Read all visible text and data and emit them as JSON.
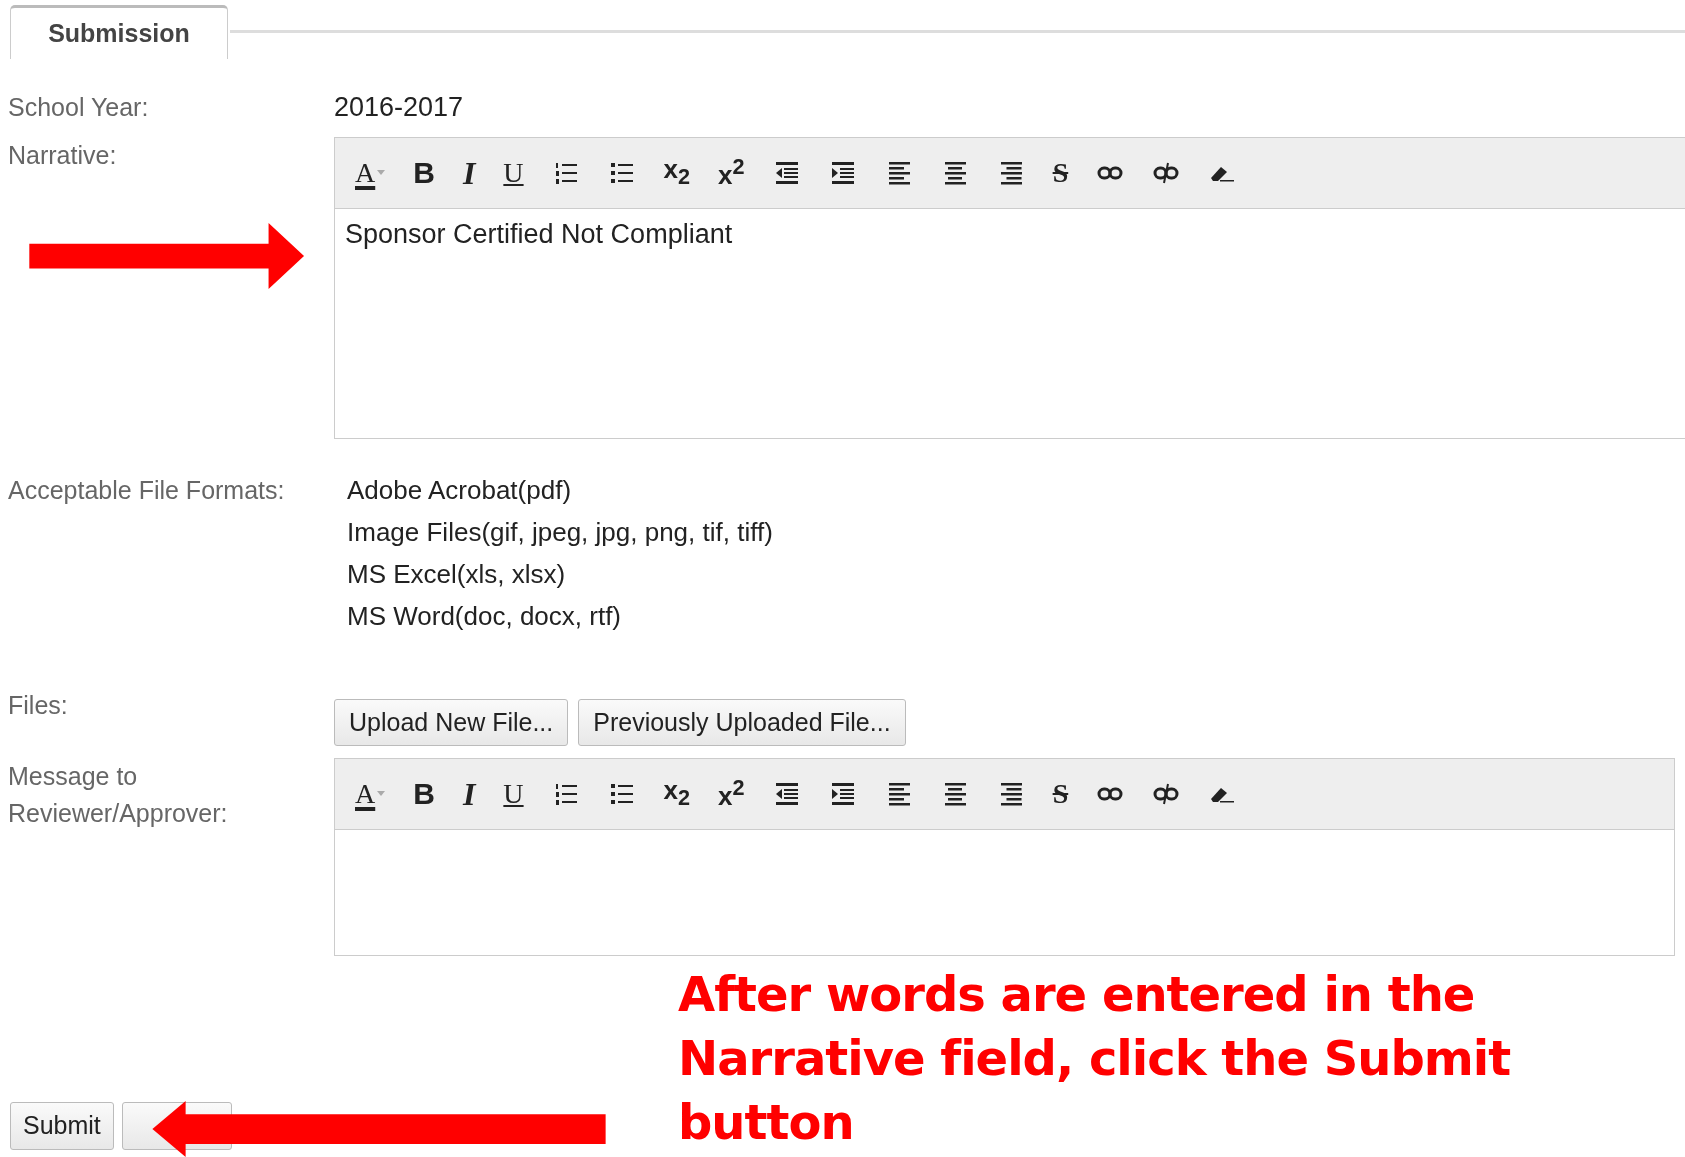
{
  "tab": {
    "label": "Submission",
    "selected": true
  },
  "school_year": {
    "label": "School Year:",
    "value": "2016-2017"
  },
  "narrative": {
    "label": "Narrative:",
    "value": "Sponsor Certified Not Compliant",
    "toolbar": [
      {
        "kind": "font-color",
        "glyph": "A"
      },
      {
        "kind": "bold",
        "glyph": "B"
      },
      {
        "kind": "italic",
        "glyph": "I"
      },
      {
        "kind": "underline",
        "glyph": "U"
      },
      {
        "kind": "ordered-list"
      },
      {
        "kind": "bullet-list"
      },
      {
        "kind": "subscript",
        "glyph": "x$_{2}$"
      },
      {
        "kind": "superscript",
        "glyph": "x$^{2}$"
      },
      {
        "kind": "outdent"
      },
      {
        "kind": "indent"
      },
      {
        "kind": "align-left"
      },
      {
        "kind": "align-center"
      },
      {
        "kind": "align-right"
      },
      {
        "kind": "strikethrough",
        "glyph": "S"
      },
      {
        "kind": "link"
      },
      {
        "kind": "unlink"
      },
      {
        "kind": "eraser"
      }
    ]
  },
  "formats": {
    "label": "Acceptable File Formats:",
    "items": [
      "Adobe Acrobat(pdf)",
      "Image Files(gif, jpeg, jpg, png, tif, tiff)",
      "MS Excel(xls, xlsx)",
      "MS Word(doc, docx, rtf)"
    ]
  },
  "files": {
    "label": "Files:",
    "buttons": [
      "Upload New File...",
      "Previously Uploaded File..."
    ]
  },
  "message": {
    "label": "Message to Reviewer/Approver:",
    "toolbar": [
      {
        "kind": "font-color",
        "glyph": "A"
      },
      {
        "kind": "bold",
        "glyph": "B"
      },
      {
        "kind": "italic",
        "glyph": "I"
      },
      {
        "kind": "underline",
        "glyph": "U"
      },
      {
        "kind": "ordered-list"
      },
      {
        "kind": "bullet-list"
      },
      {
        "kind": "subscript",
        "glyph": "x$_{2}$"
      },
      {
        "kind": "superscript",
        "glyph": "x$^{2}$"
      },
      {
        "kind": "outdent"
      },
      {
        "kind": "indent"
      },
      {
        "kind": "align-left"
      },
      {
        "kind": "align-center"
      },
      {
        "kind": "align-right"
      },
      {
        "kind": "strikethrough",
        "glyph": "S"
      },
      {
        "kind": "link"
      },
      {
        "kind": "unlink"
      },
      {
        "kind": "eraser"
      }
    ]
  },
  "submit": {
    "label": "Submit"
  },
  "annotation": {
    "text": "After words are entered in the Narrative field, click the Submit button"
  }
}
